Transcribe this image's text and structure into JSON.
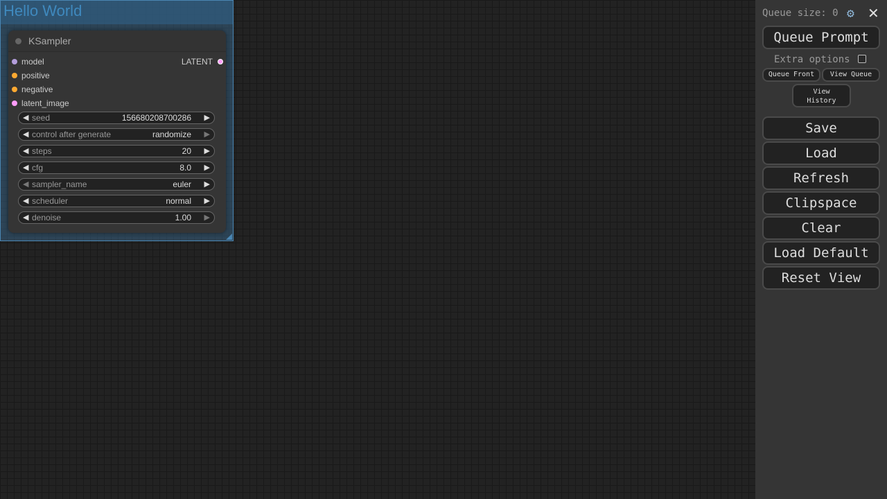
{
  "group": {
    "title": "Hello World"
  },
  "node": {
    "title": "KSampler",
    "inputs": [
      {
        "label": "model",
        "color": "#b39ddb"
      },
      {
        "label": "positive",
        "color": "#ffa931"
      },
      {
        "label": "negative",
        "color": "#ffa931"
      },
      {
        "label": "latent_image",
        "color": "#ff9cf9"
      }
    ],
    "output": {
      "label": "LATENT",
      "color": "#ff9cf9"
    },
    "widgets": [
      {
        "name": "seed",
        "value": "156680208700286"
      },
      {
        "name": "control after generate",
        "value": "randomize"
      },
      {
        "name": "steps",
        "value": "20"
      },
      {
        "name": "cfg",
        "value": "8.0"
      },
      {
        "name": "sampler_name",
        "value": "euler"
      },
      {
        "name": "scheduler",
        "value": "normal"
      },
      {
        "name": "denoise",
        "value": "1.00"
      }
    ]
  },
  "menu": {
    "queue_size_label": "Queue size: 0",
    "queue_prompt": "Queue Prompt",
    "extra_options": "Extra options",
    "queue_front": "Queue Front",
    "view_queue": "View Queue",
    "view_history": "View\nHistory",
    "save": "Save",
    "load": "Load",
    "refresh": "Refresh",
    "clipspace": "Clipspace",
    "clear": "Clear",
    "load_default": "Load Default",
    "reset_view": "Reset View"
  }
}
